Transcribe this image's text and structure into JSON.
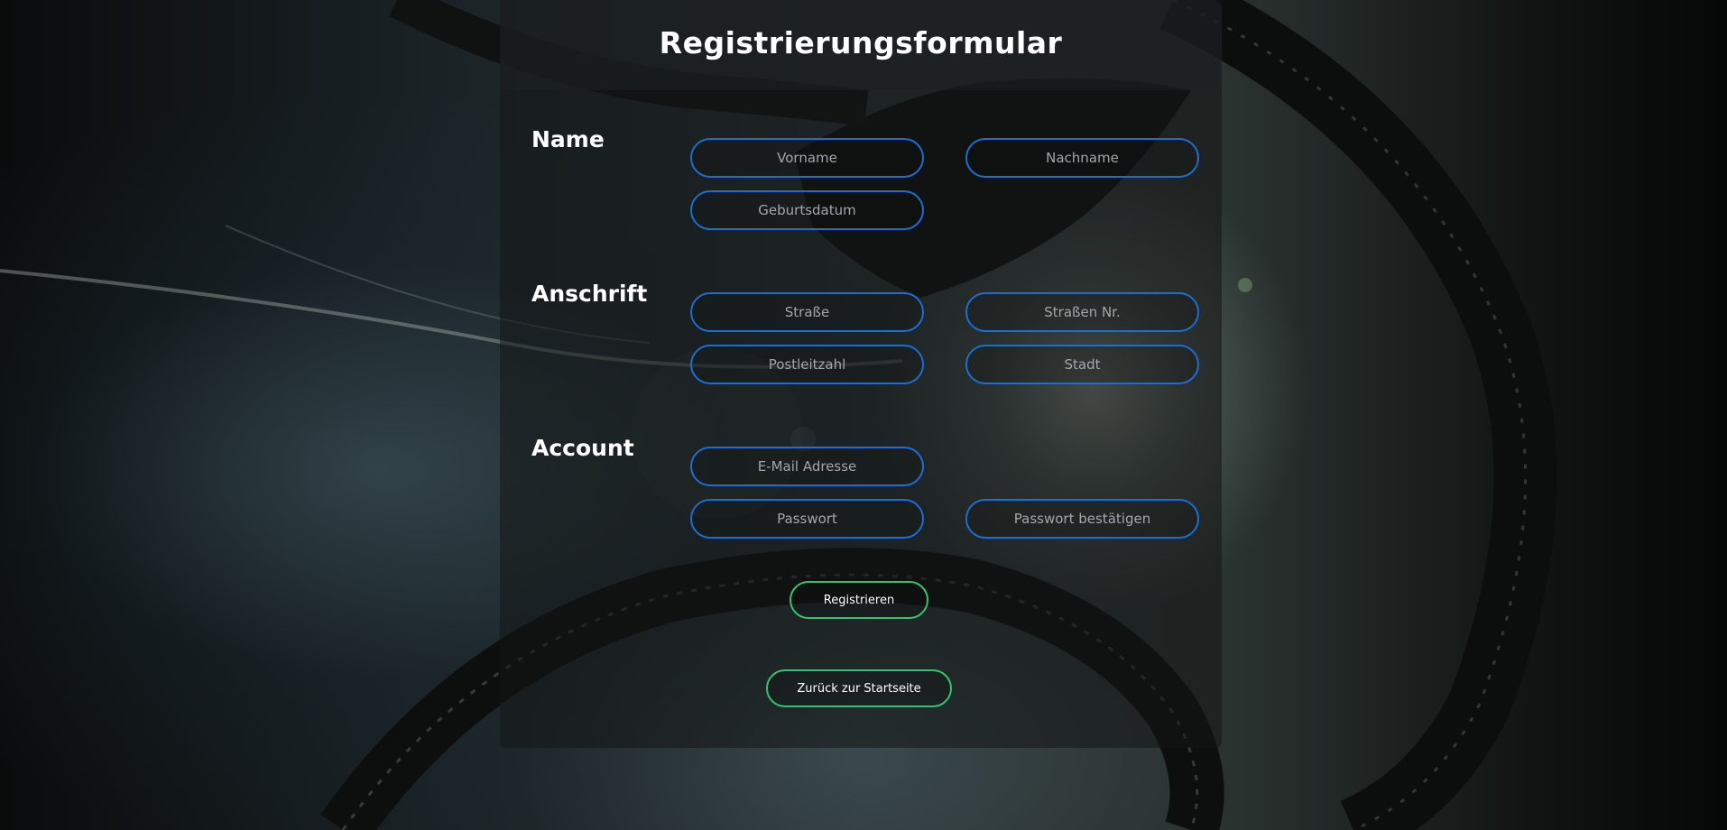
{
  "form": {
    "title": "Registrierungsformular",
    "sections": {
      "name": {
        "label": "Name",
        "fields": {
          "vorname": {
            "placeholder": "Vorname",
            "value": ""
          },
          "nachname": {
            "placeholder": "Nachname",
            "value": ""
          },
          "geburtsdatum": {
            "placeholder": "Geburtsdatum",
            "value": ""
          }
        }
      },
      "anschrift": {
        "label": "Anschrift",
        "fields": {
          "strasse": {
            "placeholder": "Straße",
            "value": ""
          },
          "strassen_nr": {
            "placeholder": "Straßen Nr.",
            "value": ""
          },
          "postleitzahl": {
            "placeholder": "Postleitzahl",
            "value": ""
          },
          "stadt": {
            "placeholder": "Stadt",
            "value": ""
          }
        }
      },
      "account": {
        "label": "Account",
        "fields": {
          "email": {
            "placeholder": "E-Mail Adresse",
            "value": ""
          },
          "passwort": {
            "placeholder": "Passwort",
            "value": ""
          },
          "passwort_bestaetigen": {
            "placeholder": "Passwort bestätigen",
            "value": ""
          }
        }
      }
    },
    "buttons": {
      "register_label": "Registrieren",
      "back_label": "Zurück zur Startseite"
    }
  },
  "colors": {
    "field_border": "#1a6fd6",
    "button_border": "#34c46a",
    "panel_background": "#141616"
  }
}
